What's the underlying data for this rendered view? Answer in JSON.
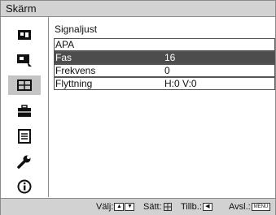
{
  "window": {
    "title": "Skärm"
  },
  "sidebar": {
    "items": [
      {
        "icon": "picture-icon",
        "selected": false
      },
      {
        "icon": "screen-settings-icon",
        "selected": false
      },
      {
        "icon": "signal-adjust-icon",
        "selected": true
      },
      {
        "icon": "suitcase-icon",
        "selected": false
      },
      {
        "icon": "list-icon",
        "selected": false
      },
      {
        "icon": "wrench-icon",
        "selected": false
      },
      {
        "icon": "info-icon",
        "selected": false
      }
    ]
  },
  "main": {
    "section_title": "Signaljust",
    "rows": [
      {
        "label": "APA",
        "value": ""
      },
      {
        "label": "Fas",
        "value": "16",
        "highlighted": true
      },
      {
        "label": "Frekvens",
        "value": "0"
      },
      {
        "label": "Flyttning",
        "value": "H:0 V:0"
      }
    ]
  },
  "footer": {
    "select_label": "Välj:",
    "set_label": "Sätt:",
    "back_label": "Tillb.:",
    "exit_label": "Avsl.:",
    "menu_key": "MENU"
  },
  "colors": {
    "highlight": "#4d4d4d",
    "bar": "#d2d2d2",
    "selected_icon": "#c4c4c4"
  }
}
